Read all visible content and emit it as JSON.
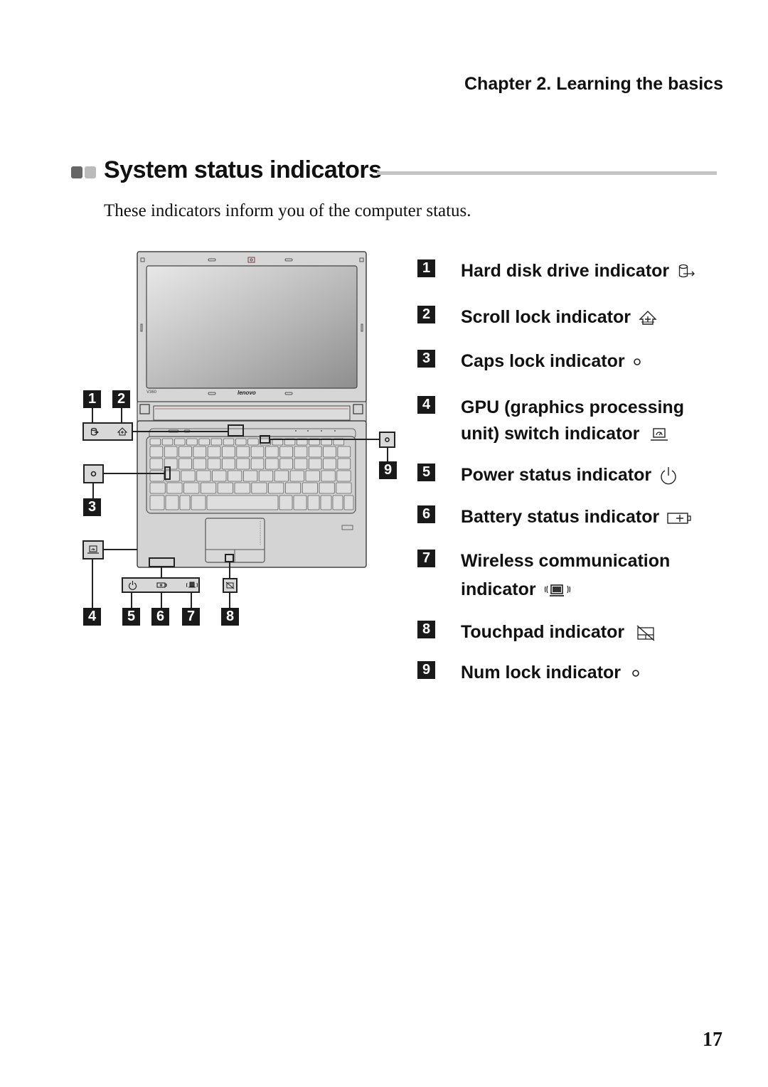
{
  "header": {
    "chapter": "Chapter 2. Learning the basics"
  },
  "section": {
    "title": "System status indicators",
    "intro": "These indicators inform you of the computer status."
  },
  "figure": {
    "model_label": "V360",
    "brand_logo": "lenovo",
    "callouts": [
      "1",
      "2",
      "3",
      "4",
      "5",
      "6",
      "7",
      "8",
      "9"
    ]
  },
  "indicators": [
    {
      "number": "1",
      "label": "Hard disk drive indicator",
      "icon": "hard-disk-icon"
    },
    {
      "number": "2",
      "label": "Scroll lock indicator",
      "icon": "scroll-lock-icon"
    },
    {
      "number": "3",
      "label": "Caps lock indicator",
      "icon": "circle-led-icon"
    },
    {
      "number": "4",
      "label_line1": "GPU (graphics processing",
      "label_line2": "unit) switch indicator",
      "icon": "gpu-switch-icon"
    },
    {
      "number": "5",
      "label": "Power status indicator",
      "icon": "power-icon"
    },
    {
      "number": "6",
      "label": "Battery status indicator",
      "icon": "battery-icon"
    },
    {
      "number": "7",
      "label_line1": "Wireless communication",
      "label_line2": "indicator",
      "icon": "wireless-icon"
    },
    {
      "number": "8",
      "label": "Touchpad indicator",
      "icon": "touchpad-off-icon"
    },
    {
      "number": "9",
      "label": "Num lock indicator",
      "icon": "circle-led-icon"
    }
  ],
  "footer": {
    "page_number": "17"
  }
}
